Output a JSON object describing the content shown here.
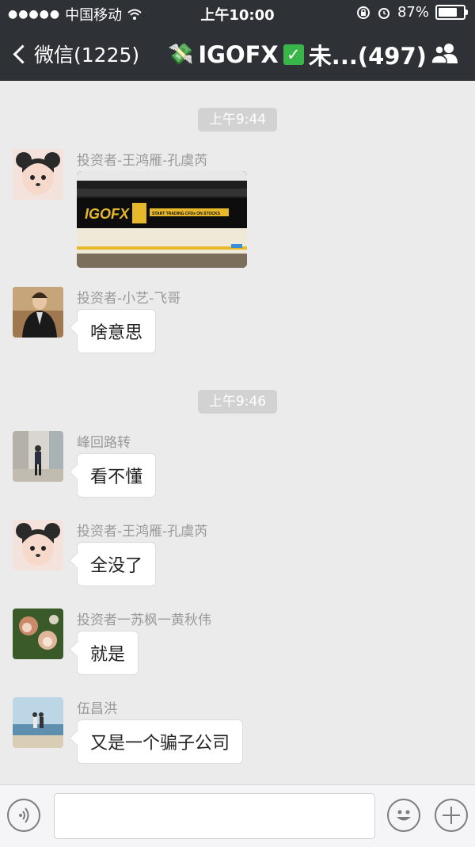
{
  "status_bar": {
    "signal": "●●●●●",
    "carrier": "中国移动",
    "time": "上午10:00",
    "battery": "87%",
    "battery_level": 0.87
  },
  "nav": {
    "back_label": "微信(1225)",
    "title_text": "IGOFX",
    "title_suffix": "未...(497)",
    "title_prefix_icon": "money-with-wings-icon",
    "title_check_icon": "check-mark-icon",
    "right_icon": "group-members-icon"
  },
  "timestamps": [
    "上午9:44",
    "上午9:46"
  ],
  "messages": [
    {
      "sender": "投资者-王鸿雁-孔虞芮",
      "type": "image",
      "image_text": "IGOFX",
      "image_caption": "START TRADING CFDs ON STOCKS"
    },
    {
      "sender": "投资者-小艺-飞哥",
      "type": "text",
      "text": "啥意思"
    },
    {
      "sender": "峰回路转",
      "type": "text",
      "text": "看不懂"
    },
    {
      "sender": "投资者-王鸿雁-孔虞芮",
      "type": "text",
      "text": "全没了"
    },
    {
      "sender": "投资者一苏枫一黄秋伟",
      "type": "text",
      "text": "就是"
    },
    {
      "sender": "伍昌洪",
      "type": "text",
      "text": "又是一个骗子公司"
    }
  ],
  "input_bar": {
    "voice_icon": "voice-icon",
    "emoji_icon": "emoji-icon",
    "plus_icon": "plus-icon",
    "input_value": ""
  },
  "colors": {
    "nav_bg": "#2e3135",
    "chat_bg": "#ebebeb",
    "bubble": "#ffffff",
    "timestamp_bg": "#d2d2d2"
  }
}
